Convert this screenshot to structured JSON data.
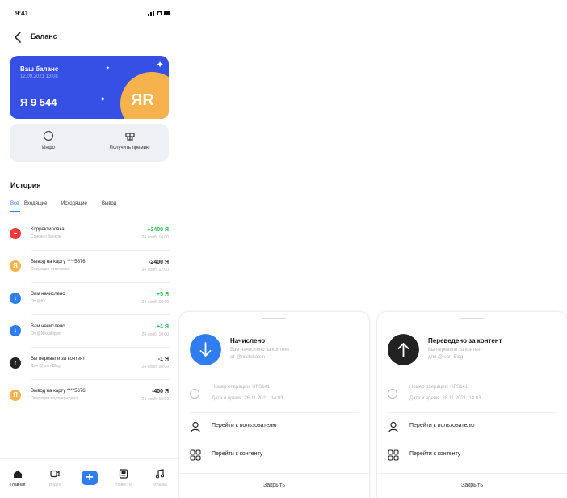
{
  "status_bar": {
    "time": "9:41",
    "icons": [
      "signal-icon",
      "wifi-icon",
      "battery-icon"
    ]
  },
  "header": {
    "back_icon": "chevron-left-icon",
    "title": "Баланс"
  },
  "balance": {
    "label": "Ваш баланс",
    "date": "12.09.2021 13:08",
    "amount": "Я 9 544",
    "coin_mark": "ЯR",
    "card_color": "#3650e6",
    "coin_color": "#f6b24c"
  },
  "actions": [
    {
      "label": "Инфо",
      "icon": "info-icon"
    },
    {
      "label": "Получить премию",
      "icon": "gift-icon"
    }
  ],
  "history": {
    "title": "История",
    "tabs": [
      "Все",
      "Входящие",
      "Исходящие",
      "Вывод"
    ],
    "active_tab": 0,
    "transactions": [
      {
        "title": "Корректировка",
        "subtitle": "Списано банком",
        "amount": "+2400 Я",
        "date": "24 нояб. 10:00",
        "icon": "minus-circle-icon",
        "icon_color": "#ef3b3b",
        "amount_color": "#2db84c"
      },
      {
        "title": "Вывод на карту ****5676",
        "subtitle": "Операция отменена",
        "amount": "-2400 Я",
        "date": "24 нояб. 12:00",
        "icon": "coin-icon",
        "icon_color": "#f6b24c",
        "amount_color": "#222222"
      },
      {
        "title": "Вам начислено",
        "subtitle": "От @Ю",
        "amount": "+5 Я",
        "date": "24 нояб. 10:00",
        "icon": "arrow-down-icon",
        "icon_color": "#2f7dee",
        "amount_color": "#2db84c"
      },
      {
        "title": "Вам начислено",
        "subtitle": "От @Nikitaflippin",
        "amount": "+1 Я",
        "date": "24 нояб. 10:00",
        "icon": "arrow-down-icon",
        "icon_color": "#2f7dee",
        "amount_color": "#2db84c"
      },
      {
        "title": "Вы перевели за контент",
        "subtitle": "Для @Ivan-Blog",
        "amount": "-1 Я",
        "date": "24 нояб. 10:00",
        "icon": "arrow-up-icon",
        "icon_color": "#222222",
        "amount_color": "#222222"
      },
      {
        "title": "Вывод на карту ****5676",
        "subtitle": "Операция подтверждена",
        "amount": "-400 Я",
        "date": "24 нояб. 10:00",
        "icon": "coin-icon",
        "icon_color": "#f6b24c",
        "amount_color": "#222222"
      }
    ]
  },
  "tabbar": [
    {
      "label": "Главная",
      "icon": "home-icon",
      "active": true
    },
    {
      "label": "Видео",
      "icon": "video-icon",
      "active": false
    },
    {
      "label": "",
      "icon": "plus-icon",
      "active": false
    },
    {
      "label": "Новости",
      "icon": "news-icon",
      "active": false
    },
    {
      "label": "Музыка",
      "icon": "music-icon",
      "active": false
    }
  ],
  "sheets": [
    {
      "title": "Начислено",
      "desc_line1": "Вам начислено за контент",
      "desc_line2": "от @nikitakatsin",
      "icon": "arrow-down-icon",
      "icon_color": "#2f7dee",
      "op_number": "Номер операции: HFS141",
      "op_date": "Дата и время: 26.11.2021, 14:03",
      "go_user": "Перейти к пользователю",
      "go_content": "Перейти к контенту",
      "close": "Закрыть"
    },
    {
      "title": "Переведено за контент",
      "desc_line1": "Вы перевели за контент",
      "desc_line2": "для @Ivan-Blog",
      "icon": "arrow-up-icon",
      "icon_color": "#222222",
      "op_number": "Номер операции: HFS141",
      "op_date": "Дата и время: 26.11.2021, 14:03",
      "go_user": "Перейти к пользователю",
      "go_content": "Перейти к контенту",
      "close": "Закрыть"
    }
  ]
}
